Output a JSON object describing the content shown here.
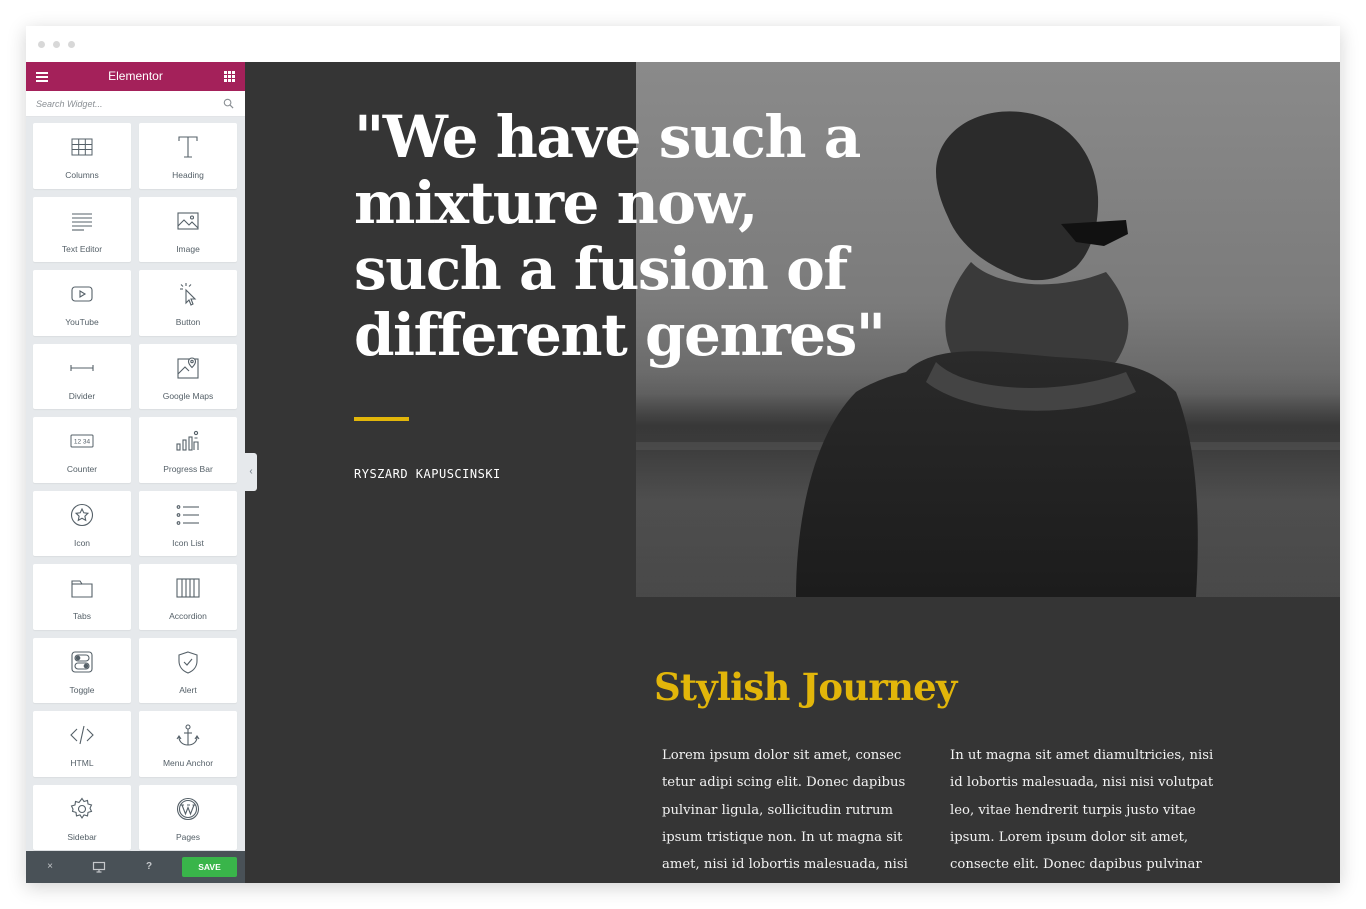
{
  "colors": {
    "brand": "#a4215a",
    "accent": "#e2b60a",
    "save": "#39b54a",
    "canvas_bg": "#353535",
    "panel_bg": "#e6e9ec",
    "footer_bg": "#495157"
  },
  "editor": {
    "title": "Elementor",
    "search_placeholder": "Search Widget...",
    "widgets": [
      {
        "label": "Columns",
        "icon": "columns-icon"
      },
      {
        "label": "Heading",
        "icon": "heading-icon"
      },
      {
        "label": "Text Editor",
        "icon": "text-editor-icon"
      },
      {
        "label": "Image",
        "icon": "image-icon"
      },
      {
        "label": "YouTube",
        "icon": "youtube-icon"
      },
      {
        "label": "Button",
        "icon": "button-icon"
      },
      {
        "label": "Divider",
        "icon": "divider-icon"
      },
      {
        "label": "Google Maps",
        "icon": "google-maps-icon"
      },
      {
        "label": "Counter",
        "icon": "counter-icon"
      },
      {
        "label": "Progress Bar",
        "icon": "progress-bar-icon"
      },
      {
        "label": "Icon",
        "icon": "star-icon"
      },
      {
        "label": "Icon List",
        "icon": "icon-list-icon"
      },
      {
        "label": "Tabs",
        "icon": "tabs-icon"
      },
      {
        "label": "Accordion",
        "icon": "accordion-icon"
      },
      {
        "label": "Toggle",
        "icon": "toggle-icon"
      },
      {
        "label": "Alert",
        "icon": "alert-icon"
      },
      {
        "label": "HTML",
        "icon": "html-icon"
      },
      {
        "label": "Menu Anchor",
        "icon": "anchor-icon"
      },
      {
        "label": "Sidebar",
        "icon": "gear-icon"
      },
      {
        "label": "Pages",
        "icon": "wordpress-icon"
      }
    ],
    "counter_icon_text": "12 34",
    "footer": {
      "close_icon": "×",
      "responsive_icon": "monitor-icon",
      "help_icon": "?",
      "save_label": "SAVE"
    }
  },
  "page": {
    "quote": "\"We have such a mixture now, such a fusion of different genres\"",
    "author": "RYSZARD KAPUSCINSKI",
    "section_title": "Stylish Journey",
    "col1": "Lorem ipsum dolor sit amet, consec tetur adipi scing elit. Donec dapibus pulvinar ligula, sollicitudin rutrum ipsum tristique non. In ut magna sit amet, nisi id lobortis malesuada, nisi nisi volutpat leo, vitae",
    "col2": "In ut magna sit amet diamultricies, nisi id lobortis malesuada, nisi nisi volutpat leo, vitae hendrerit turpis justo vitae ipsum. Lorem ipsum dolor sit amet, consecte elit. Donec dapibus pulvinar ligula, sollicitudin"
  }
}
